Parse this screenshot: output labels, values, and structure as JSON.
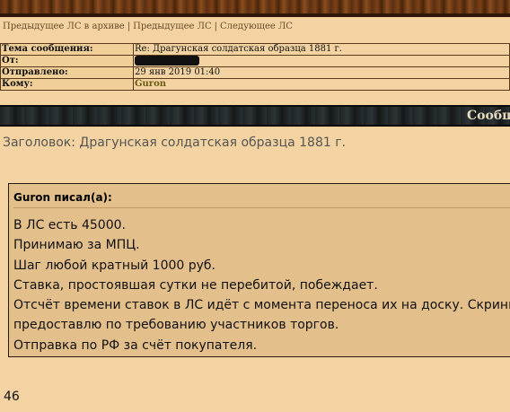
{
  "nav": {
    "prev_archive": "Предыдущее ЛС в архиве",
    "prev": "Предыдущее ЛС",
    "next": "Следующее ЛС",
    "sep": "|"
  },
  "header": {
    "subject_label": "Тема сообщения:",
    "subject_value": "Re: Драгунская солдатская образца 1881 г.",
    "from_label": "От:",
    "from_value": "",
    "sent_label": "Отправлено:",
    "sent_value": "29 янв 2019 01:40",
    "to_label": "Кому:",
    "to_value": "Guron"
  },
  "banner": {
    "title": "Сообщ"
  },
  "message": {
    "subject": "Заголовок: Драгунская солдатская образца 1881 г.",
    "quote_author": "Guron писал(а):",
    "quote_lines": [
      "В ЛС есть 45000.",
      "Принимаю за МПЦ.",
      "Шаг любой кратный 1000 руб.",
      "Ставка, простоявшая сутки не перебитой, побеждает.",
      "Отсчёт времени ставок в ЛС идёт с момента переноса их на доску. Скрины",
      "предоставлю по требованию участников торгов.",
      "Отправка по РФ за счёт покупателя."
    ],
    "reply_text": "46"
  }
}
